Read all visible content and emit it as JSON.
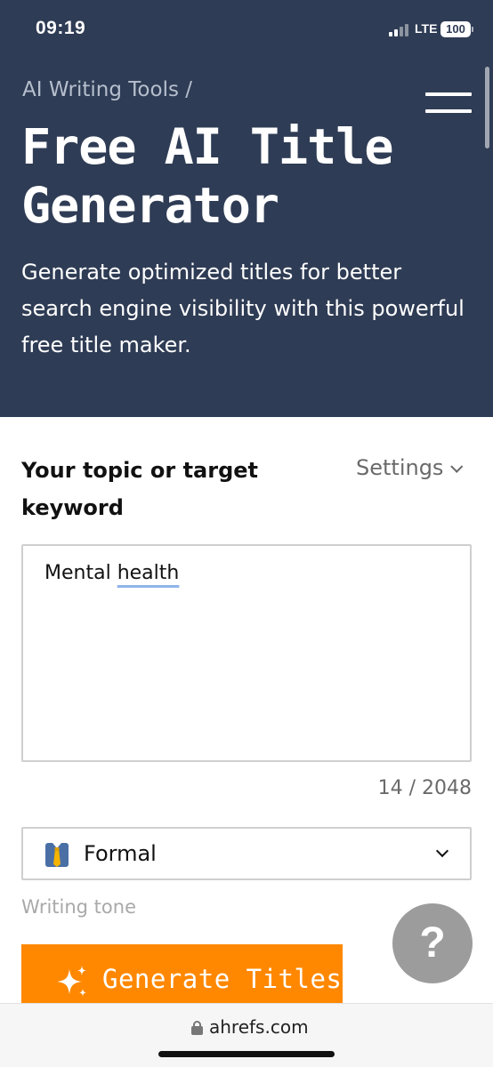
{
  "status_bar": {
    "time": "09:19",
    "network": "LTE",
    "battery": "100"
  },
  "header": {
    "breadcrumb": "AI Writing Tools /",
    "title": "Free AI Title Generator",
    "subtitle": "Generate optimized titles for better search engine visibility with this powerful free title maker.",
    "background_color": "#2f3c55",
    "menu_icon": "hamburger-menu-icon"
  },
  "form": {
    "topic_label": "Your topic or target keyword",
    "settings_label": "Settings",
    "topic_value_prefix": "Mental ",
    "topic_value_underlined": "health",
    "char_counter": "14 / 2048",
    "tone": {
      "selected": "Formal",
      "icon": "necktie-emoji-icon",
      "caption": "Writing tone"
    },
    "generate_label": "Generate Titles",
    "generate_icon": "sparkles-icon",
    "accent_color": "#ff8800"
  },
  "help": {
    "label": "?"
  },
  "browser": {
    "url": "ahrefs.com",
    "lock_icon": "lock-icon"
  }
}
